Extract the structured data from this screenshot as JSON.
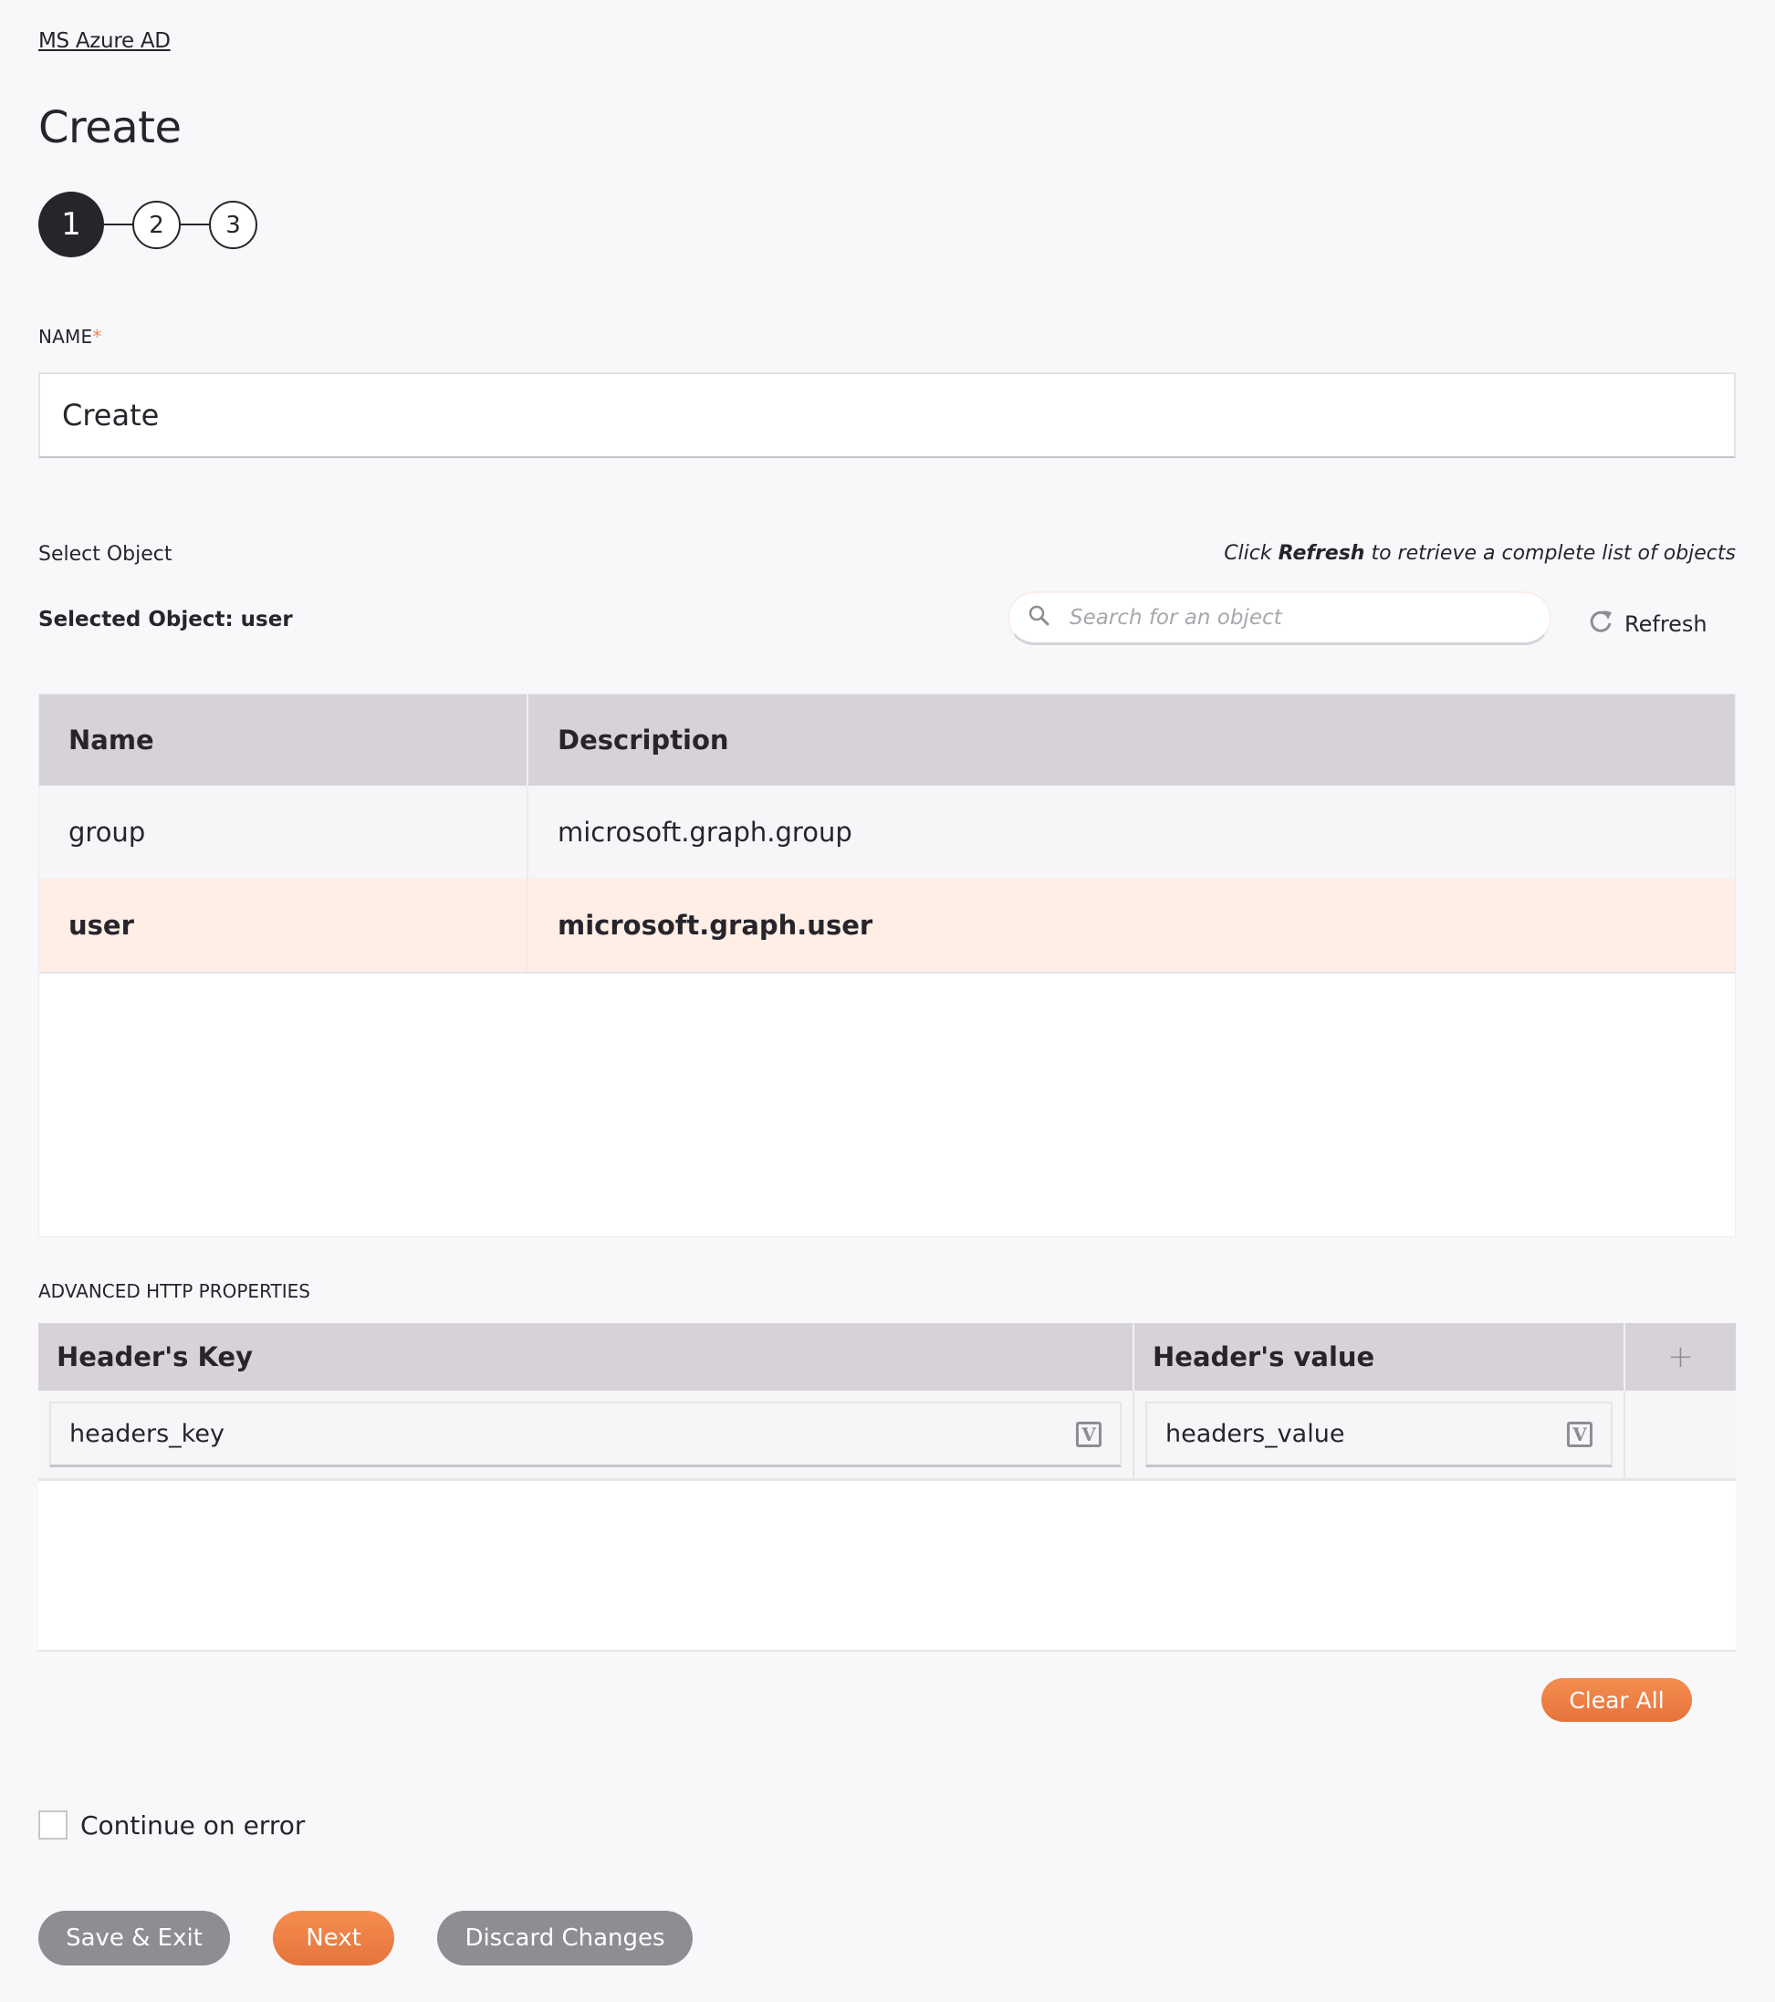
{
  "breadcrumb": "MS Azure AD",
  "page_title": "Create",
  "stepper": {
    "steps": [
      "1",
      "2",
      "3"
    ],
    "current": 1
  },
  "name_field": {
    "label": "NAME",
    "required_mark": "*",
    "value": "Create"
  },
  "select_object": {
    "label": "Select Object",
    "hint_prefix": "Click ",
    "hint_bold": "Refresh",
    "hint_suffix": " to retrieve a complete list of objects",
    "selected_text": "Selected Object: user",
    "search_placeholder": "Search for an object",
    "search_value": "",
    "refresh_label": "Refresh"
  },
  "objects_table": {
    "columns": [
      "Name",
      "Description"
    ],
    "rows": [
      {
        "name": "group",
        "description": "microsoft.graph.group",
        "selected": false
      },
      {
        "name": "user",
        "description": "microsoft.graph.user",
        "selected": true
      }
    ]
  },
  "advanced_http": {
    "label": "ADVANCED HTTP PROPERTIES",
    "columns": [
      "Header's Key",
      "Header's value"
    ],
    "add_icon": "+",
    "rows": [
      {
        "key": "headers_key",
        "value": "headers_value"
      }
    ],
    "variable_icon_glyph": "V",
    "clear_all_label": "Clear All"
  },
  "continue_on_error": {
    "label": "Continue on error",
    "checked": false
  },
  "footer": {
    "save_exit_label": "Save & Exit",
    "next_label": "Next",
    "discard_label": "Discard Changes"
  },
  "colors": {
    "accent_orange": "#ec7d44",
    "selected_row": "#feeee6",
    "header_bg": "#d6d2d8",
    "grey_button": "#8f8c93",
    "dark": "#27252b"
  }
}
